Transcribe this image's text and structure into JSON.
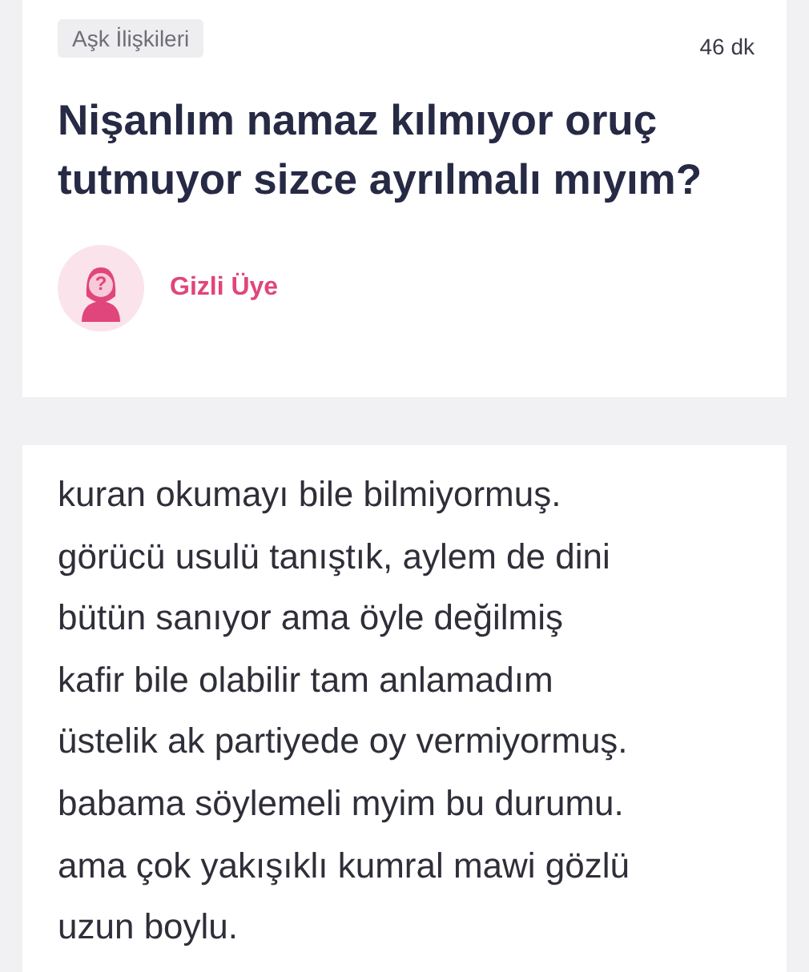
{
  "category": "Aşk İlişkileri",
  "time": "46 dk",
  "title": "Nişanlım namaz kılmıyor oruç tutmuyor sizce ayrılmalı mıyım?",
  "author": {
    "name": "Gizli Üye",
    "avatar_mark": "?"
  },
  "body": [
    "kuran okumayı bile bilmiyormuş.",
    "görücü usulü tanıştık, aylem de dini",
    "bütün sanıyor ama öyle değilmiş",
    "kafir bile olabilir tam anlamadım",
    "üstelik ak partiyede oy vermiyormuş.",
    "babama söylemeli myim bu durumu.",
    "ama çok yakışıklı kumral mawi gözlü",
    "uzun boylu."
  ]
}
